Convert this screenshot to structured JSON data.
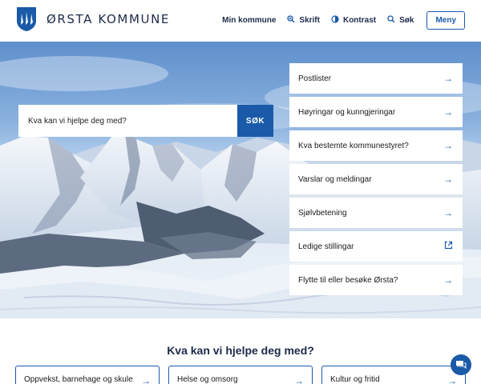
{
  "header": {
    "logo_text": "ØRSTA KOMMUNE",
    "nav": [
      {
        "label": "Min kommune",
        "icon": ""
      },
      {
        "label": "Skrift",
        "icon": "zoom-icon"
      },
      {
        "label": "Kontrast",
        "icon": "contrast-icon"
      },
      {
        "label": "Søk",
        "icon": "search-icon"
      }
    ],
    "menu_label": "Meny"
  },
  "search": {
    "placeholder": "Kva kan vi hjelpe deg med?",
    "button_label": "SØK"
  },
  "quick_links": [
    {
      "label": "Postlister",
      "icon": "arrow-right-icon"
    },
    {
      "label": "Høyringar og kunngjeringar",
      "icon": "arrow-right-icon"
    },
    {
      "label": "Kva bestemte kommunestyret?",
      "icon": "arrow-right-icon"
    },
    {
      "label": "Varslar og meldingar",
      "icon": "arrow-right-icon"
    },
    {
      "label": "Sjølvbetening",
      "icon": "arrow-right-icon"
    },
    {
      "label": "Ledige stillingar",
      "icon": "external-link-icon"
    },
    {
      "label": "Flytte til eller besøke Ørsta?",
      "icon": "arrow-right-icon"
    }
  ],
  "help": {
    "title": "Kva kan vi hjelpe deg med?",
    "cards": [
      {
        "label": "Oppvekst, barnehage og skule"
      },
      {
        "label": "Helse og omsorg"
      },
      {
        "label": "Kultur og fritid"
      }
    ]
  },
  "colors": {
    "accent": "#1a5aa8",
    "brand_dark": "#1e2a4a"
  }
}
